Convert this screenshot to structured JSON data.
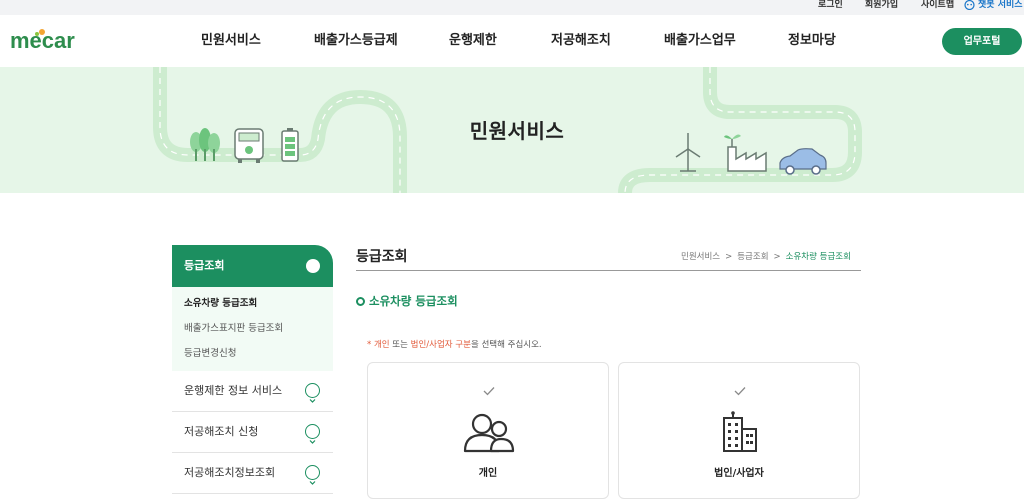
{
  "topbar": {
    "login": "로그인",
    "signup": "회원가입",
    "sitemap": "사이트맵",
    "chatbot": "챗봇 서비스"
  },
  "header": {
    "logo_text": "mecar",
    "nav": [
      "민원서비스",
      "배출가스등급제",
      "운행제한",
      "저공해조치",
      "배출가스업무",
      "정보마당"
    ],
    "portal_button": "업무포털"
  },
  "hero": {
    "title": "민원서비스"
  },
  "sidebar": {
    "active_section": "등급조회",
    "sub_items": [
      "소유차량 등급조회",
      "배출가스표지판 등급조회",
      "등급변경신청"
    ],
    "items": [
      "운행제한 정보 서비스",
      "저공해조치 신청",
      "저공해조치정보조회"
    ]
  },
  "content": {
    "title": "등급조회",
    "breadcrumb": [
      "민원서비스",
      "등급조회",
      "소유차량 등급조회"
    ],
    "breadcrumb_sep": ">",
    "section_title": "소유차량 등급조회",
    "notice": {
      "star": "*",
      "part1": "개인",
      "part2": " 또는 ",
      "part3": "법인/사업자 구분",
      "part4": "을 선택해 주십시오."
    },
    "cards": [
      {
        "label": "개인",
        "icon": "people-icon"
      },
      {
        "label": "법인/사업자",
        "icon": "building-icon"
      }
    ]
  },
  "colors": {
    "brand_green": "#1c8f60",
    "hero_bg": "#e6f6e8",
    "road": "#cdeccf",
    "accent_red": "#e25b3b",
    "chatbot_blue": "#1a76c9"
  }
}
